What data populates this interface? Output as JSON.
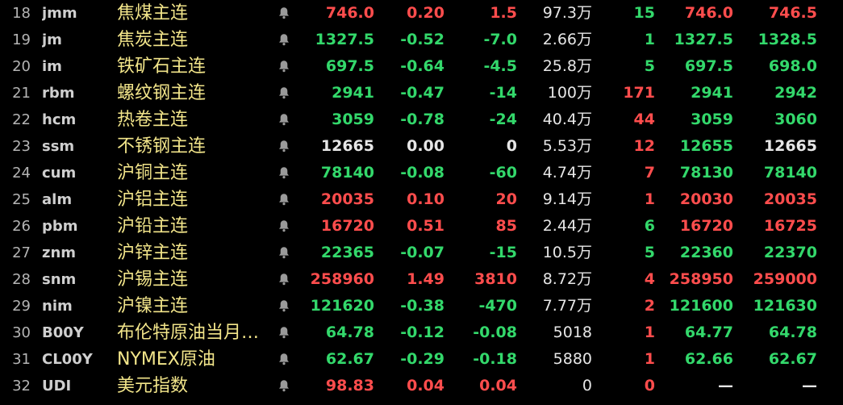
{
  "colors": {
    "background": "#000000",
    "index": "#b4b4b4",
    "code": "#cfcfcf",
    "name": "#f2e58a",
    "up": "#ff4d4d",
    "down": "#33d86b",
    "flat": "#e6e6e6",
    "bell": "#9a9a9a"
  },
  "bell_icon": "bell-icon",
  "rows": [
    {
      "idx": "18",
      "code": "jmm",
      "name": "焦煤主连",
      "price": "746.0",
      "price_dir": "up",
      "pct": "0.20",
      "pct_dir": "up",
      "chg": "1.5",
      "chg_dir": "up",
      "vol": "97.3万",
      "cur": "15",
      "cur_dir": "down",
      "bid": "746.0",
      "bid_dir": "up",
      "ask": "746.5",
      "ask_dir": "up"
    },
    {
      "idx": "19",
      "code": "jm",
      "name": "焦炭主连",
      "price": "1327.5",
      "price_dir": "down",
      "pct": "-0.52",
      "pct_dir": "down",
      "chg": "-7.0",
      "chg_dir": "down",
      "vol": "2.66万",
      "cur": "1",
      "cur_dir": "down",
      "bid": "1327.5",
      "bid_dir": "down",
      "ask": "1328.5",
      "ask_dir": "down"
    },
    {
      "idx": "20",
      "code": "im",
      "name": "铁矿石主连",
      "price": "697.5",
      "price_dir": "down",
      "pct": "-0.64",
      "pct_dir": "down",
      "chg": "-4.5",
      "chg_dir": "down",
      "vol": "25.8万",
      "cur": "5",
      "cur_dir": "down",
      "bid": "697.5",
      "bid_dir": "down",
      "ask": "698.0",
      "ask_dir": "down"
    },
    {
      "idx": "21",
      "code": "rbm",
      "name": "螺纹钢主连",
      "price": "2941",
      "price_dir": "down",
      "pct": "-0.47",
      "pct_dir": "down",
      "chg": "-14",
      "chg_dir": "down",
      "vol": "100万",
      "cur": "171",
      "cur_dir": "up",
      "bid": "2941",
      "bid_dir": "down",
      "ask": "2942",
      "ask_dir": "down"
    },
    {
      "idx": "22",
      "code": "hcm",
      "name": "热卷主连",
      "price": "3059",
      "price_dir": "down",
      "pct": "-0.78",
      "pct_dir": "down",
      "chg": "-24",
      "chg_dir": "down",
      "vol": "40.4万",
      "cur": "44",
      "cur_dir": "up",
      "bid": "3059",
      "bid_dir": "down",
      "ask": "3060",
      "ask_dir": "down"
    },
    {
      "idx": "23",
      "code": "ssm",
      "name": "不锈钢主连",
      "price": "12665",
      "price_dir": "flat",
      "pct": "0.00",
      "pct_dir": "flat",
      "chg": "0",
      "chg_dir": "flat",
      "vol": "5.53万",
      "cur": "12",
      "cur_dir": "up",
      "bid": "12655",
      "bid_dir": "down",
      "ask": "12665",
      "ask_dir": "flat"
    },
    {
      "idx": "24",
      "code": "cum",
      "name": "沪铜主连",
      "price": "78140",
      "price_dir": "down",
      "pct": "-0.08",
      "pct_dir": "down",
      "chg": "-60",
      "chg_dir": "down",
      "vol": "4.74万",
      "cur": "7",
      "cur_dir": "up",
      "bid": "78130",
      "bid_dir": "down",
      "ask": "78140",
      "ask_dir": "down"
    },
    {
      "idx": "25",
      "code": "alm",
      "name": "沪铝主连",
      "price": "20035",
      "price_dir": "up",
      "pct": "0.10",
      "pct_dir": "up",
      "chg": "20",
      "chg_dir": "up",
      "vol": "9.14万",
      "cur": "1",
      "cur_dir": "up",
      "bid": "20030",
      "bid_dir": "up",
      "ask": "20035",
      "ask_dir": "up"
    },
    {
      "idx": "26",
      "code": "pbm",
      "name": "沪铅主连",
      "price": "16720",
      "price_dir": "up",
      "pct": "0.51",
      "pct_dir": "up",
      "chg": "85",
      "chg_dir": "up",
      "vol": "2.44万",
      "cur": "6",
      "cur_dir": "down",
      "bid": "16720",
      "bid_dir": "up",
      "ask": "16725",
      "ask_dir": "up"
    },
    {
      "idx": "27",
      "code": "znm",
      "name": "沪锌主连",
      "price": "22365",
      "price_dir": "down",
      "pct": "-0.07",
      "pct_dir": "down",
      "chg": "-15",
      "chg_dir": "down",
      "vol": "10.5万",
      "cur": "5",
      "cur_dir": "down",
      "bid": "22360",
      "bid_dir": "down",
      "ask": "22370",
      "ask_dir": "down"
    },
    {
      "idx": "28",
      "code": "snm",
      "name": "沪锡主连",
      "price": "258960",
      "price_dir": "up",
      "pct": "1.49",
      "pct_dir": "up",
      "chg": "3810",
      "chg_dir": "up",
      "vol": "8.72万",
      "cur": "4",
      "cur_dir": "up",
      "bid": "258950",
      "bid_dir": "up",
      "ask": "259000",
      "ask_dir": "up"
    },
    {
      "idx": "29",
      "code": "nim",
      "name": "沪镍主连",
      "price": "121620",
      "price_dir": "down",
      "pct": "-0.38",
      "pct_dir": "down",
      "chg": "-470",
      "chg_dir": "down",
      "vol": "7.77万",
      "cur": "2",
      "cur_dir": "up",
      "bid": "121600",
      "bid_dir": "down",
      "ask": "121630",
      "ask_dir": "down"
    },
    {
      "idx": "30",
      "code": "B00Y",
      "name": "布伦特原油当月…",
      "price": "64.78",
      "price_dir": "down",
      "pct": "-0.12",
      "pct_dir": "down",
      "chg": "-0.08",
      "chg_dir": "down",
      "vol": "5018",
      "cur": "1",
      "cur_dir": "up",
      "bid": "64.77",
      "bid_dir": "down",
      "ask": "64.78",
      "ask_dir": "down"
    },
    {
      "idx": "31",
      "code": "CL00Y",
      "name": "NYMEX原油",
      "price": "62.67",
      "price_dir": "down",
      "pct": "-0.29",
      "pct_dir": "down",
      "chg": "-0.18",
      "chg_dir": "down",
      "vol": "5880",
      "cur": "1",
      "cur_dir": "up",
      "bid": "62.66",
      "bid_dir": "down",
      "ask": "62.67",
      "ask_dir": "down"
    },
    {
      "idx": "32",
      "code": "UDI",
      "name": "美元指数",
      "price": "98.83",
      "price_dir": "up",
      "pct": "0.04",
      "pct_dir": "up",
      "chg": "0.04",
      "chg_dir": "up",
      "vol": "0",
      "cur": "0",
      "cur_dir": "up",
      "bid": "—",
      "bid_dir": "flat",
      "ask": "—",
      "ask_dir": "flat"
    }
  ]
}
